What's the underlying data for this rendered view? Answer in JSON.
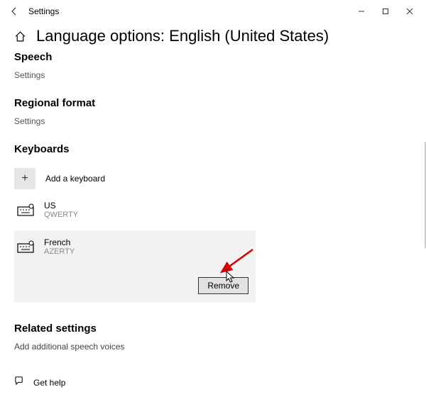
{
  "titleBar": {
    "appName": "Settings"
  },
  "page": {
    "title": "Language options: English (United States)"
  },
  "sections": {
    "speech": {
      "heading": "Speech",
      "link": "Settings"
    },
    "regional": {
      "heading": "Regional format",
      "link": "Settings"
    },
    "keyboards": {
      "heading": "Keyboards",
      "addLabel": "Add a keyboard",
      "items": [
        {
          "name": "US",
          "layout": "QWERTY"
        },
        {
          "name": "French",
          "layout": "AZERTY"
        }
      ],
      "removeLabel": "Remove"
    },
    "related": {
      "heading": "Related settings",
      "link": "Add additional speech voices"
    },
    "help": {
      "label": "Get help"
    }
  }
}
